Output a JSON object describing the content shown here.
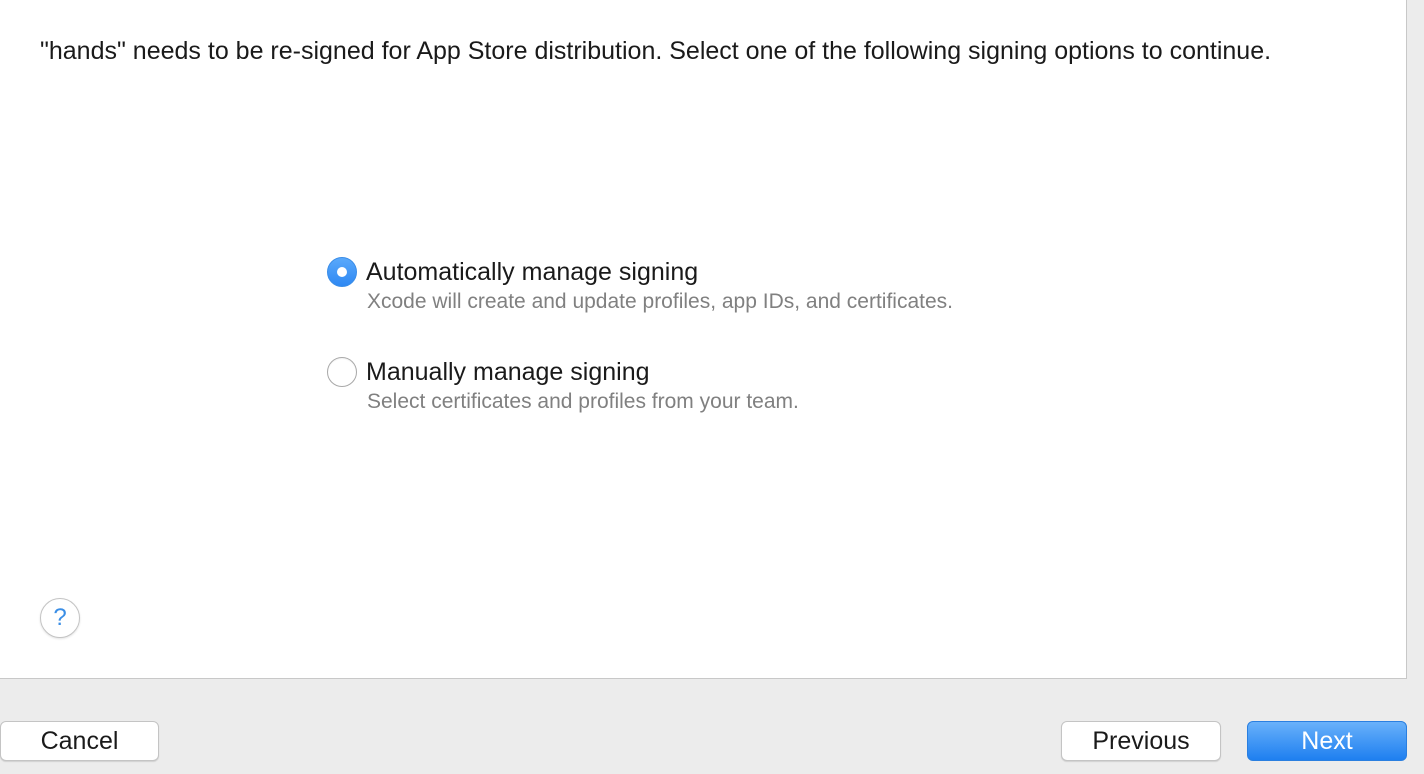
{
  "message": "\"hands\" needs to be re-signed for App Store distribution. Select one of the following signing options to continue.",
  "signing_options": [
    {
      "title": "Automatically manage signing",
      "description": "Xcode will create and update profiles, app IDs, and certificates.",
      "selected": true
    },
    {
      "title": "Manually manage signing",
      "description": "Select certificates and profiles from your team.",
      "selected": false
    }
  ],
  "help": {
    "symbol": "?",
    "icon": "question-mark-icon"
  },
  "buttons": {
    "cancel": "Cancel",
    "previous": "Previous",
    "next": "Next"
  },
  "colors": {
    "accent": "#2e88f3",
    "content_background": "#ffffff",
    "window_background": "#ececec",
    "secondary_text": "#808080"
  }
}
